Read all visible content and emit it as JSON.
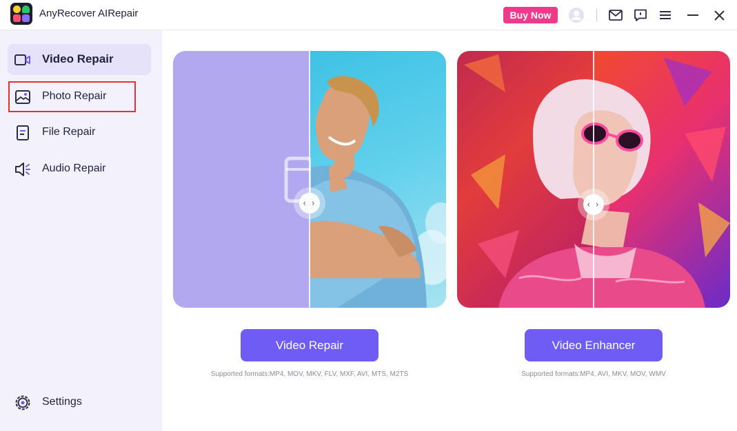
{
  "app": {
    "title": "AnyRecover AIRepair"
  },
  "titlebar": {
    "buy_label": "Buy Now",
    "icons": [
      "user-avatar-icon",
      "mail-icon",
      "feedback-icon",
      "menu-icon",
      "minimize-icon",
      "close-icon"
    ]
  },
  "sidebar": {
    "items": [
      {
        "label": "Video Repair",
        "icon": "video-camera-icon",
        "active": true
      },
      {
        "label": "Photo Repair",
        "icon": "photo-icon",
        "highlighted": true
      },
      {
        "label": "File Repair",
        "icon": "document-icon"
      },
      {
        "label": "Audio Repair",
        "icon": "speaker-icon"
      }
    ],
    "settings_label": "Settings"
  },
  "cards": [
    {
      "button_label": "Video Repair",
      "formats": "Supported formats:MP4, MOV, MKV, FLV, MXF, AVI, MTS, M2TS"
    },
    {
      "button_label": "Video Enhancer",
      "formats": "Supported formats:MP4, AVI, MKV, MOV, WMV"
    }
  ],
  "colors": {
    "accent": "#6f5cf5",
    "buy": "#f0398a",
    "sidebar_bg": "#f3f2fc",
    "active_bg": "#e5e2fa",
    "highlight_border": "#e0322f"
  }
}
